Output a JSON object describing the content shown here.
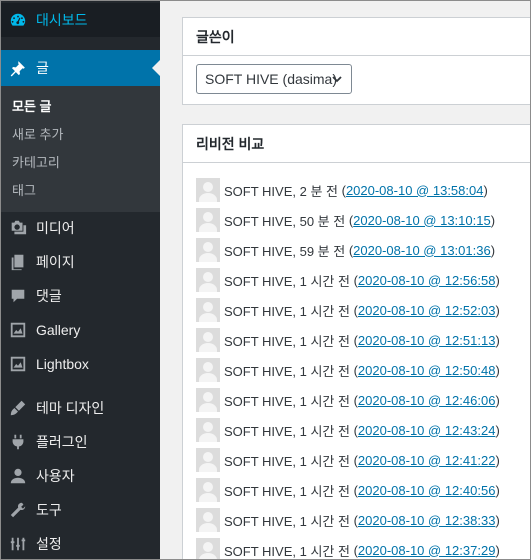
{
  "sidebar": {
    "dashboard": "대시보드",
    "posts": "글",
    "submenu": [
      "모든 글",
      "새로 추가",
      "카테고리",
      "태그"
    ],
    "items": [
      "미디어",
      "페이지",
      "댓글",
      "Gallery",
      "Lightbox",
      "테마 디자인",
      "플러그인",
      "사용자",
      "도구",
      "설정"
    ],
    "icons": [
      "media-icon",
      "pages-icon",
      "comments-icon",
      "gallery-icon",
      "lightbox-icon",
      "appearance-icon",
      "plugins-icon",
      "users-icon",
      "tools-icon",
      "settings-icon"
    ]
  },
  "author": {
    "title": "글쓴이",
    "selected": "SOFT HIVE (dasima)"
  },
  "revisions": {
    "title": "리비전 비교",
    "rows": [
      {
        "who": "SOFT HIVE, 2 분 전",
        "date": "2020-08-10 @ 13:58:04"
      },
      {
        "who": "SOFT HIVE, 50 분 전",
        "date": "2020-08-10 @ 13:10:15"
      },
      {
        "who": "SOFT HIVE, 59 분 전",
        "date": "2020-08-10 @ 13:01:36"
      },
      {
        "who": "SOFT HIVE, 1 시간 전",
        "date": "2020-08-10 @ 12:56:58"
      },
      {
        "who": "SOFT HIVE, 1 시간 전",
        "date": "2020-08-10 @ 12:52:03"
      },
      {
        "who": "SOFT HIVE, 1 시간 전",
        "date": "2020-08-10 @ 12:51:13"
      },
      {
        "who": "SOFT HIVE, 1 시간 전",
        "date": "2020-08-10 @ 12:50:48"
      },
      {
        "who": "SOFT HIVE, 1 시간 전",
        "date": "2020-08-10 @ 12:46:06"
      },
      {
        "who": "SOFT HIVE, 1 시간 전",
        "date": "2020-08-10 @ 12:43:24"
      },
      {
        "who": "SOFT HIVE, 1 시간 전",
        "date": "2020-08-10 @ 12:41:22"
      },
      {
        "who": "SOFT HIVE, 1 시간 전",
        "date": "2020-08-10 @ 12:40:56"
      },
      {
        "who": "SOFT HIVE, 1 시간 전",
        "date": "2020-08-10 @ 12:38:33"
      },
      {
        "who": "SOFT HIVE, 1 시간 전",
        "date": "2020-08-10 @ 12:37:29"
      }
    ]
  },
  "colors": {
    "sidebar": "#23282d",
    "active": "#0073aa",
    "dashboard_accent": "#00b9eb"
  }
}
